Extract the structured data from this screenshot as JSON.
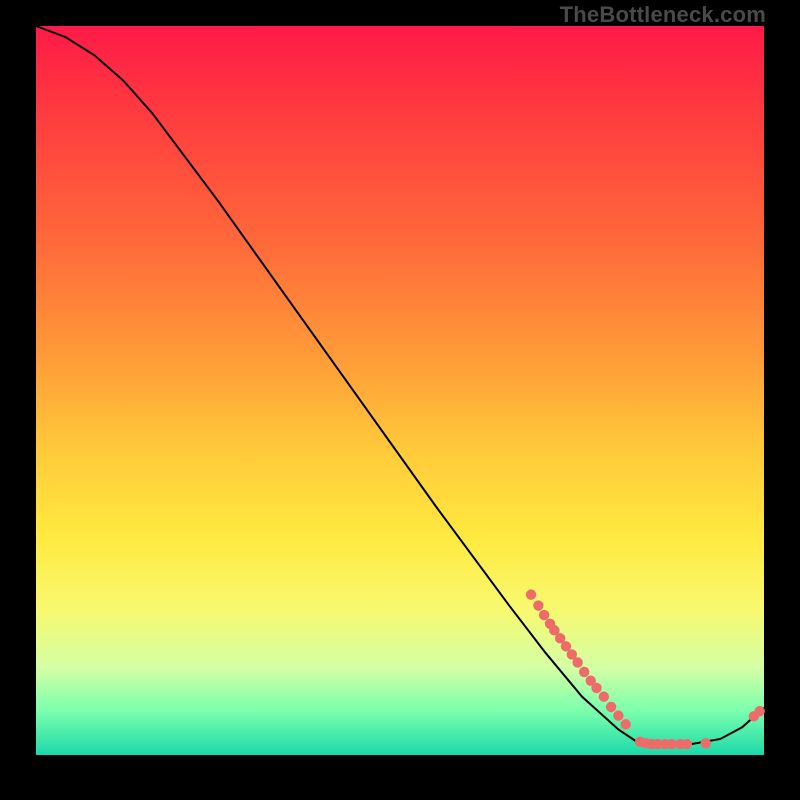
{
  "watermark": "TheBottleneck.com",
  "colors": {
    "marker": "#ed6c69",
    "curve": "#000000",
    "gradient_top": "#ff1a47",
    "gradient_bottom": "#1bd9a9",
    "page_bg": "#000000"
  },
  "chart_data": {
    "type": "line",
    "title": "",
    "xlabel": "",
    "ylabel": "",
    "xlim": [
      0,
      100
    ],
    "ylim": [
      0,
      100
    ],
    "grid": false,
    "legend": false,
    "curve": [
      {
        "x": 0,
        "y": 100
      },
      {
        "x": 4,
        "y": 98.5
      },
      {
        "x": 8,
        "y": 96
      },
      {
        "x": 12,
        "y": 92.5
      },
      {
        "x": 16,
        "y": 88
      },
      {
        "x": 25,
        "y": 76
      },
      {
        "x": 35,
        "y": 62
      },
      {
        "x": 45,
        "y": 48
      },
      {
        "x": 55,
        "y": 34
      },
      {
        "x": 65,
        "y": 20.5
      },
      {
        "x": 70,
        "y": 14
      },
      {
        "x": 75,
        "y": 8
      },
      {
        "x": 80,
        "y": 3.5
      },
      {
        "x": 83,
        "y": 1.5
      },
      {
        "x": 86,
        "y": 1.5
      },
      {
        "x": 90,
        "y": 1.5
      },
      {
        "x": 94,
        "y": 2.2
      },
      {
        "x": 97,
        "y": 3.8
      },
      {
        "x": 100,
        "y": 6.5
      }
    ],
    "markers": [
      {
        "x": 68,
        "y": 22
      },
      {
        "x": 69,
        "y": 20.5
      },
      {
        "x": 69.8,
        "y": 19.2
      },
      {
        "x": 70.6,
        "y": 18
      },
      {
        "x": 71.2,
        "y": 17.1
      },
      {
        "x": 72,
        "y": 16
      },
      {
        "x": 72.8,
        "y": 14.9
      },
      {
        "x": 73.6,
        "y": 13.8
      },
      {
        "x": 74.4,
        "y": 12.7
      },
      {
        "x": 75.3,
        "y": 11.4
      },
      {
        "x": 76.2,
        "y": 10.2
      },
      {
        "x": 77,
        "y": 9.2
      },
      {
        "x": 78,
        "y": 8
      },
      {
        "x": 79,
        "y": 6.6
      },
      {
        "x": 80,
        "y": 5.4
      },
      {
        "x": 81,
        "y": 4.2
      },
      {
        "x": 83,
        "y": 1.8
      },
      {
        "x": 83.8,
        "y": 1.6
      },
      {
        "x": 84.6,
        "y": 1.5
      },
      {
        "x": 85.4,
        "y": 1.5
      },
      {
        "x": 86.4,
        "y": 1.5
      },
      {
        "x": 87.3,
        "y": 1.5
      },
      {
        "x": 88.5,
        "y": 1.5
      },
      {
        "x": 89.4,
        "y": 1.5
      },
      {
        "x": 92,
        "y": 1.6
      },
      {
        "x": 98.6,
        "y": 5.3
      },
      {
        "x": 99.4,
        "y": 6
      }
    ],
    "marker_radius_px": 5.2
  }
}
